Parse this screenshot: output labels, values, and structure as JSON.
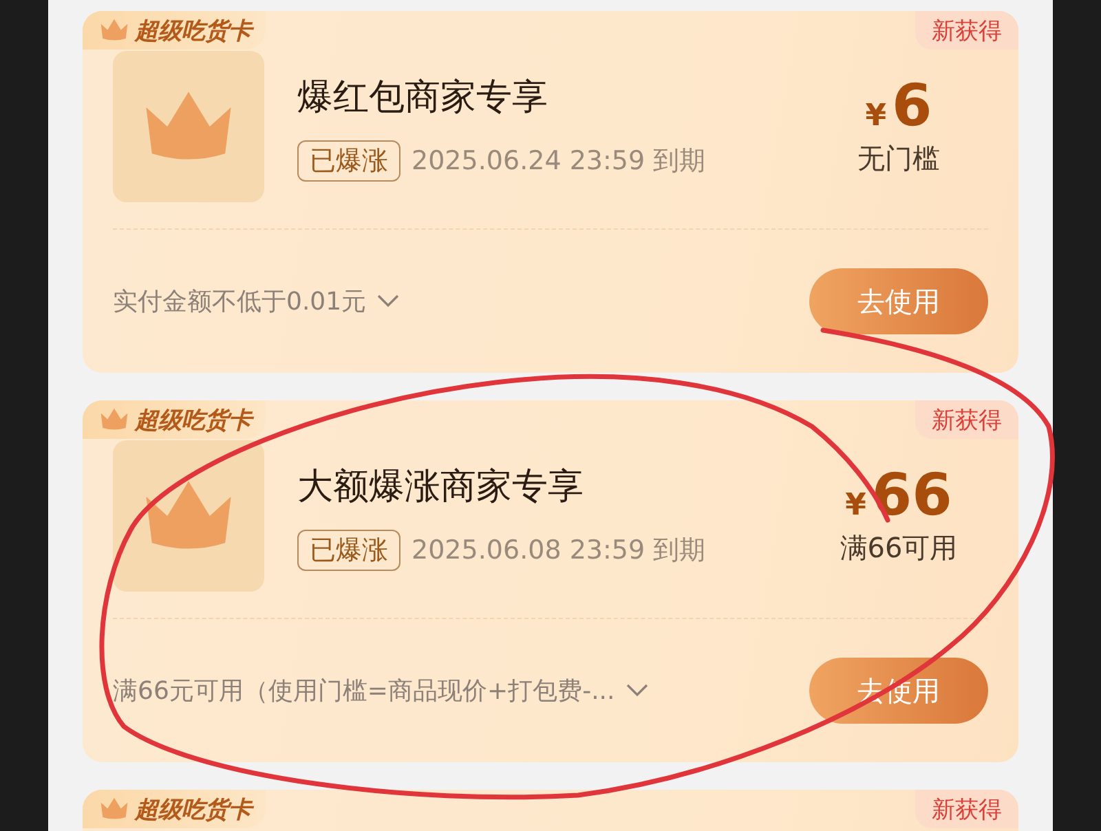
{
  "cards": [
    {
      "badge": "超级吃货卡",
      "tag": "新获得",
      "title": "爆红包商家专享",
      "status": "已爆涨",
      "expiry": "2025.06.24 23:59 到期",
      "currency": "¥",
      "amount": "6",
      "condition": "无门槛",
      "note": "实付金额不低于0.01元",
      "button": "去使用"
    },
    {
      "badge": "超级吃货卡",
      "tag": "新获得",
      "title": "大额爆涨商家专享",
      "status": "已爆涨",
      "expiry": "2025.06.08 23:59 到期",
      "currency": "¥",
      "amount": "66",
      "condition": "满66可用",
      "note": "满66元可用（使用门槛=商品现价+打包费-...",
      "button": "去使用"
    },
    {
      "badge": "超级吃货卡",
      "tag": "新获得"
    }
  ]
}
